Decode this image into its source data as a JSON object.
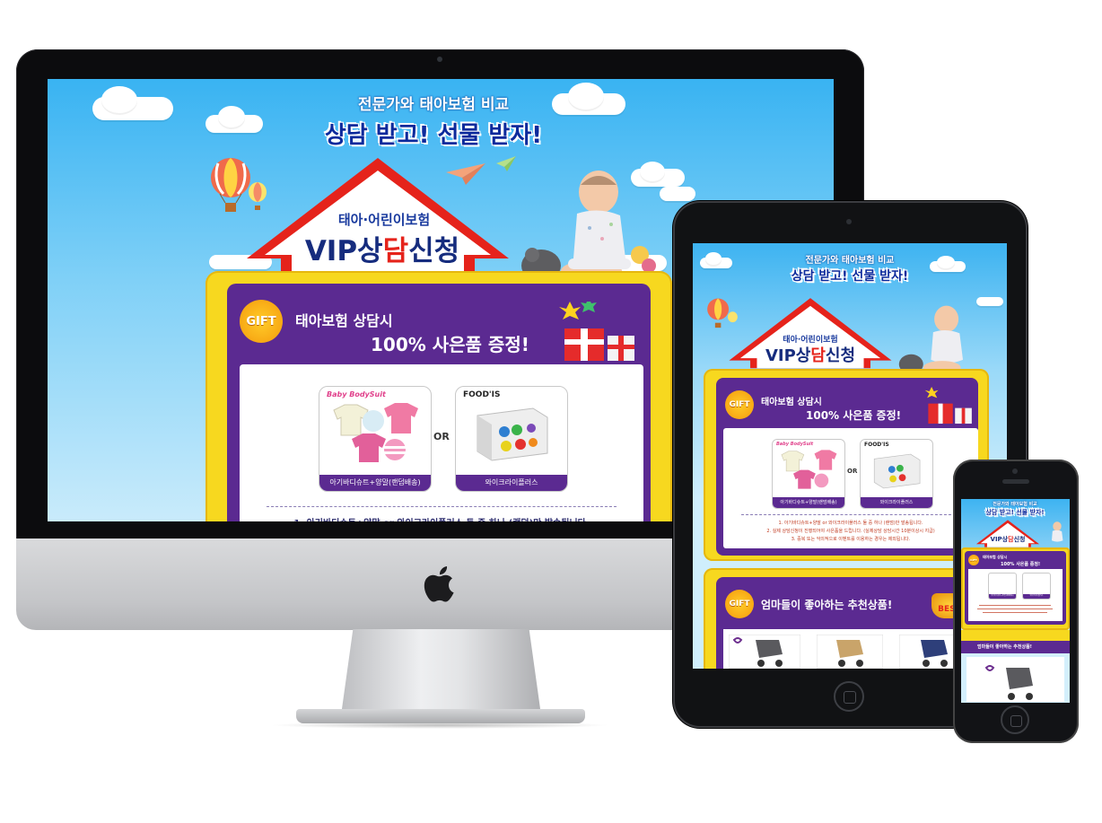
{
  "page": {
    "headline_sub": "전문가와 태아보험 비교",
    "headline_main": "상담 받고! 선물 받자!",
    "house_small": "태아·어린이보험",
    "house_big_prefix": "VIP상",
    "house_big_accent": "담",
    "house_big_suffix": "신청",
    "gift_badge": "GIFT",
    "gift_title_line1": "태아보험 상담시",
    "gift_title_line2": "100% 사은품 증정!",
    "or_label": "OR",
    "products": [
      {
        "caption": "아기바디슈트+양말(랜덤배송)",
        "brand": "Baby BodySuit"
      },
      {
        "caption": "와이크라이플러스",
        "brand": "FOOD'IS"
      }
    ],
    "notes": [
      "1. 아기바디슈트+양말 or 와이크라이플러스 둘 중 하나 (랜덤)만 발송됩니다.",
      "2. 실제 상담신청이 진행되어야 사은품을 드립니다. (실제상담 상담시간 10분이상시 지급)",
      "3. 중복 또는 악의적으로 이벤트를 이용하는 경우는 제외됩니다."
    ],
    "best_title": "엄마들이 좋아하는 추천상품!",
    "best_badge": "BEST"
  },
  "colors": {
    "sky": "#39b3f2",
    "purple": "#5b2a91",
    "yellow": "#f7d81f",
    "roof_red": "#e5231b",
    "accent_red": "#e5231b",
    "navy": "#0c2a9c"
  }
}
